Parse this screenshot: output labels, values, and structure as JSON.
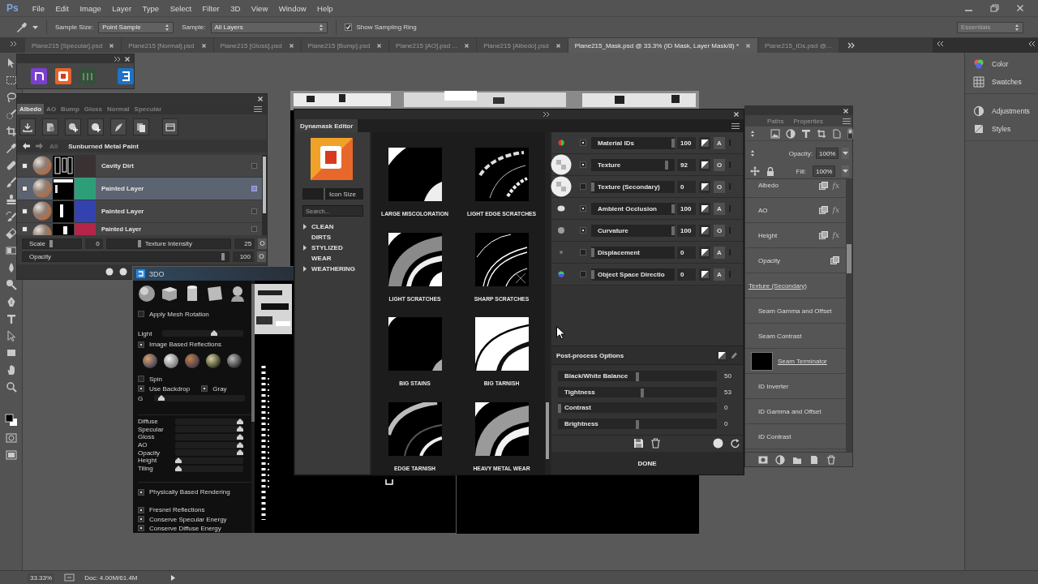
{
  "menubar": {
    "logo": "Ps",
    "menus": [
      "File",
      "Edit",
      "Image",
      "Layer",
      "Type",
      "Select",
      "Filter",
      "3D",
      "View",
      "Window",
      "Help"
    ]
  },
  "options_bar": {
    "sample_size_label": "Sample Size:",
    "sample_size": "Point Sample",
    "sample_label": "Sample:",
    "sample": "All Layers",
    "sampling_ring": {
      "label": "Show Sampling Ring",
      "checked": true
    },
    "workspace": "Essentials"
  },
  "document_tabs": [
    {
      "title": "Plane215 [Specular].psd",
      "selected": false,
      "closable": true
    },
    {
      "title": "Plane215 [Normal].psd",
      "selected": false,
      "closable": true
    },
    {
      "title": "Plane215 [Gloss].psd",
      "selected": false,
      "closable": true
    },
    {
      "title": "Plane215 [Bump].psd",
      "selected": false,
      "closable": true
    },
    {
      "title": "Plane215 [AO].psd ...",
      "selected": false,
      "closable": true
    },
    {
      "title": "Plane215 [Albedo].psd",
      "selected": false,
      "closable": true
    },
    {
      "title": "Plane215_Mask.psd @ 33.3% (ID Mask, Layer Mask/8) *",
      "selected": true,
      "closable": true
    },
    {
      "title": "Plane215_IDs.psd @...",
      "selected": false,
      "closable": false
    }
  ],
  "texture_panel": {
    "tabs": [
      {
        "label": "Albedo",
        "selected": true
      },
      {
        "label": "AO",
        "selected": false
      },
      {
        "label": "Bump",
        "selected": false
      },
      {
        "label": "Gloss",
        "selected": false
      },
      {
        "label": "Normal",
        "selected": false
      },
      {
        "label": "Specular",
        "selected": false
      }
    ],
    "breadcrumb": [
      {
        "label": "All",
        "selected": false
      },
      {
        "label": "Sunburned Metal Paint",
        "selected": true
      }
    ],
    "layers": [
      {
        "name": "Cavity Dirt",
        "checked": true,
        "selected": false,
        "color": "#3a3232"
      },
      {
        "name": "Painted Layer",
        "checked": true,
        "selected": true,
        "color": "#2e9e78"
      },
      {
        "name": "Painted Layer",
        "checked": true,
        "selected": false,
        "color": "#3442b0"
      },
      {
        "name": "Painted Layer",
        "checked": true,
        "selected": false,
        "color": "#b4254a"
      }
    ],
    "scale": {
      "label": "Scale",
      "level": 0.48,
      "value": "0"
    },
    "texture_intensity": {
      "label": "Texture Intensity",
      "level": 0.26,
      "value": "25"
    },
    "opacity": {
      "label": "Opacity",
      "level": 0.98,
      "value": "100"
    }
  },
  "viewer_3do": {
    "title": "3DO",
    "apply_mesh_rotation": {
      "label": "Apply Mesh Rotation",
      "checked": false
    },
    "light": {
      "label": "Light",
      "level": 0.65
    },
    "image_based_reflections": {
      "label": "Image Based Reflections",
      "checked": true
    },
    "spin": {
      "label": "Spin",
      "checked": false
    },
    "use_backdrop": {
      "label": "Use Backdrop",
      "checked": true
    },
    "gray": {
      "label": "Gray",
      "checked": true
    },
    "g": {
      "label": "G",
      "level": 0.05
    },
    "material_sliders": [
      {
        "label": "Diffuse",
        "level": 1
      },
      {
        "label": "Specular",
        "level": 1
      },
      {
        "label": "Gloss",
        "level": 1
      },
      {
        "label": "AO",
        "level": 1
      },
      {
        "label": "Opacity",
        "level": 1
      },
      {
        "label": "Height",
        "level": 0
      },
      {
        "label": "Tiling",
        "level": 0
      }
    ],
    "physically_based_rendering": {
      "label": "Physically Based Rendering",
      "checked": true
    },
    "fresnel_reflections": {
      "label": "Fresnel Reflections",
      "checked": true
    },
    "conserve_specular_energy": {
      "label": "Conserve Specular Energy",
      "checked": true
    },
    "conserve_diffuse_energy": {
      "label": "Conserve Diffuse Energy",
      "checked": true
    }
  },
  "dynamask": {
    "title": "Dynamask Editor",
    "icon_size": {
      "label": "Icon Size",
      "level": 0.36
    },
    "search": {
      "placeholder": "Search..."
    },
    "categories": [
      {
        "label": "CLEAN",
        "kind": "group"
      },
      {
        "label": "DIRTS",
        "kind": "leaf"
      },
      {
        "label": "STYLIZED",
        "kind": "group"
      },
      {
        "label": "WEAR",
        "kind": "leaf"
      },
      {
        "label": "WEATHERING",
        "kind": "group"
      }
    ],
    "masks": [
      {
        "label": "LARGE MISCOLORATION"
      },
      {
        "label": "LIGHT EDGE SCRATCHES"
      },
      {
        "label": "LIGHT SCRATCHES"
      },
      {
        "label": "SHARP SCRATCHES"
      },
      {
        "label": "BIG STAINS"
      },
      {
        "label": "BIG TARNISH"
      },
      {
        "label": "EDGE TARNISH"
      },
      {
        "label": "HEAVY METAL WEAR"
      }
    ],
    "channels": [
      {
        "name": "Material IDs",
        "checked": true,
        "level": 1,
        "value": "100",
        "mode": "A"
      },
      {
        "name": "Texture",
        "checked": true,
        "level": 0.92,
        "value": "92",
        "mode": "O"
      },
      {
        "name": "Texture (Secondary)",
        "checked": false,
        "level": 0,
        "value": "0",
        "mode": "O"
      },
      {
        "name": "Ambient Occlusion",
        "checked": true,
        "level": 1,
        "value": "100",
        "mode": "A"
      },
      {
        "name": "Curvature",
        "checked": true,
        "level": 1,
        "value": "100",
        "mode": "O"
      },
      {
        "name": "Displacement",
        "checked": false,
        "level": 0,
        "value": "0",
        "mode": "A"
      },
      {
        "name": "Object Space Directio",
        "checked": false,
        "level": 0,
        "value": "0",
        "mode": "A"
      }
    ],
    "post_process": {
      "title": "Post-process Options",
      "sliders": [
        {
          "label": "Black/White Balance",
          "level": 0.5,
          "value": "50"
        },
        {
          "label": "Tightness",
          "level": 0.53,
          "value": "53"
        },
        {
          "label": "Contrast",
          "level": 0,
          "value": "0"
        },
        {
          "label": "Brightness",
          "level": 0.5,
          "value": "0"
        }
      ]
    },
    "done": "DONE"
  },
  "layers_panel": {
    "tabs": [
      "Paths",
      "Properties"
    ],
    "opacity_label": "Opacity:",
    "opacity": "100%",
    "fill_label": "Fill:",
    "fill": "100%",
    "layers": [
      {
        "name": "Albedo",
        "clip_base": false,
        "thumbnail": false,
        "mask_link": true,
        "badge": "fx"
      },
      {
        "name": "AO",
        "clip_base": false,
        "thumbnail": false,
        "mask_link": true,
        "badge": "fx"
      },
      {
        "name": "Height",
        "clip_base": false,
        "thumbnail": false,
        "mask_link": true,
        "badge": "fx"
      },
      {
        "name": "Opacity",
        "clip_base": false,
        "thumbnail": false,
        "mask_link": true
      },
      {
        "name": "Texture (Secondary)",
        "clip_base": true,
        "thumbnail": false,
        "mask_link": false
      },
      {
        "name": "Seam Gamma and Offset",
        "clip_base": false,
        "thumbnail": false,
        "mask_link": false
      },
      {
        "name": "Seam Contrast",
        "clip_base": false,
        "thumbnail": false,
        "mask_link": false
      },
      {
        "name": "Seam Terminator",
        "clip_base": true,
        "thumbnail": true,
        "mask_link": false
      },
      {
        "name": "ID Inverter",
        "clip_base": false,
        "thumbnail": false,
        "mask_link": false
      },
      {
        "name": "ID Gamma and Offset",
        "clip_base": false,
        "thumbnail": false,
        "mask_link": false
      },
      {
        "name": "ID Contrast",
        "clip_base": false,
        "thumbnail": false,
        "mask_link": false
      }
    ]
  },
  "dock_groups": [
    [
      "Color",
      "Swatches"
    ],
    [
      "Adjustments",
      "Styles"
    ]
  ],
  "status_bar": {
    "zoom": "33.33%",
    "doc_info": "Doc: 4.00M/61.4M"
  }
}
